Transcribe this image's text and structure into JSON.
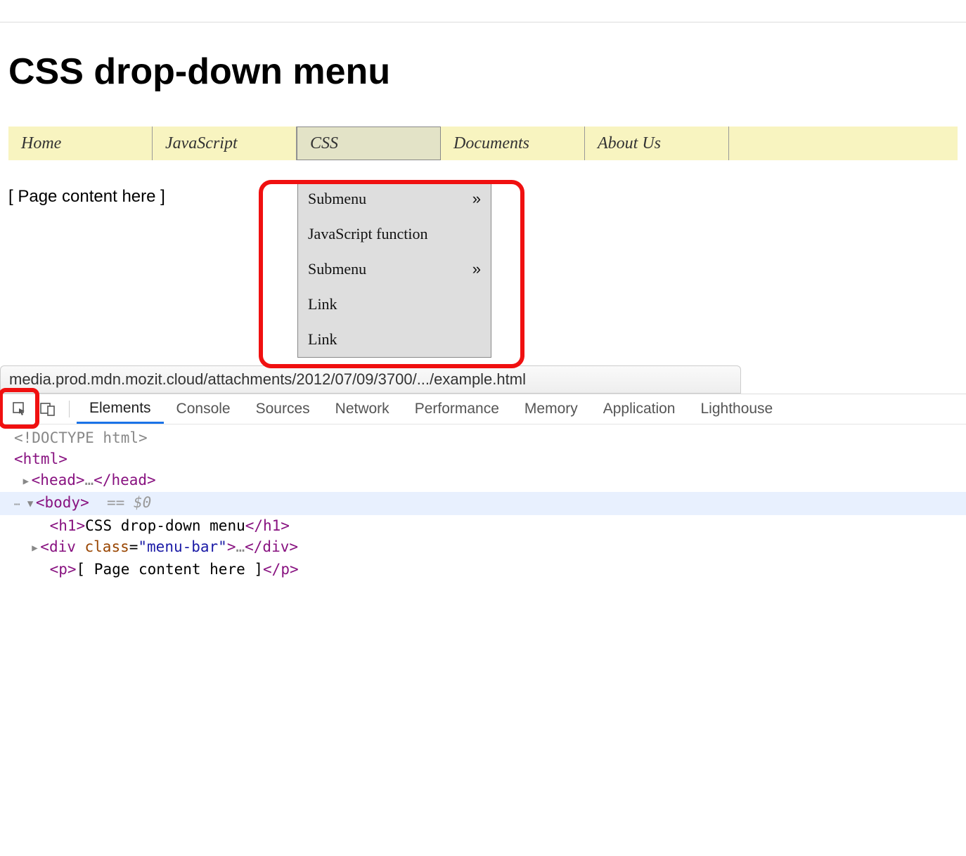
{
  "page": {
    "heading": "CSS drop-down menu",
    "content_text": "[ Page content here ]"
  },
  "menu": {
    "items": [
      "Home",
      "JavaScript",
      "CSS",
      "Documents",
      "About Us"
    ],
    "active_index": 2
  },
  "dropdown": {
    "items": [
      {
        "label": "Submenu",
        "has_sub": true
      },
      {
        "label": "JavaScript function",
        "has_sub": false
      },
      {
        "label": "Submenu",
        "has_sub": true
      },
      {
        "label": "Link",
        "has_sub": false
      },
      {
        "label": "Link",
        "has_sub": false
      }
    ],
    "arrow_glyph": "»"
  },
  "url": "media.prod.mdn.mozit.cloud/attachments/2012/07/09/3700/.../example.html",
  "devtools": {
    "tabs": [
      "Elements",
      "Console",
      "Sources",
      "Network",
      "Performance",
      "Memory",
      "Application",
      "Lighthouse"
    ],
    "active_tab_index": 0,
    "code": {
      "doctype": "<!DOCTYPE html>",
      "html_open": "<html>",
      "head": "<head>…</head>",
      "body_open": "<body>",
      "body_eq": "== $0",
      "h1_line_open": "<h1>",
      "h1_text": "CSS drop-down menu",
      "h1_line_close": "</h1>",
      "div_open1": "<div ",
      "div_attr_name": "class",
      "div_attr_val": "menu-bar",
      "div_close1": ">…</div>",
      "p_open": "<p>",
      "p_text": "[ Page content here ]",
      "p_close": "</p>"
    }
  }
}
